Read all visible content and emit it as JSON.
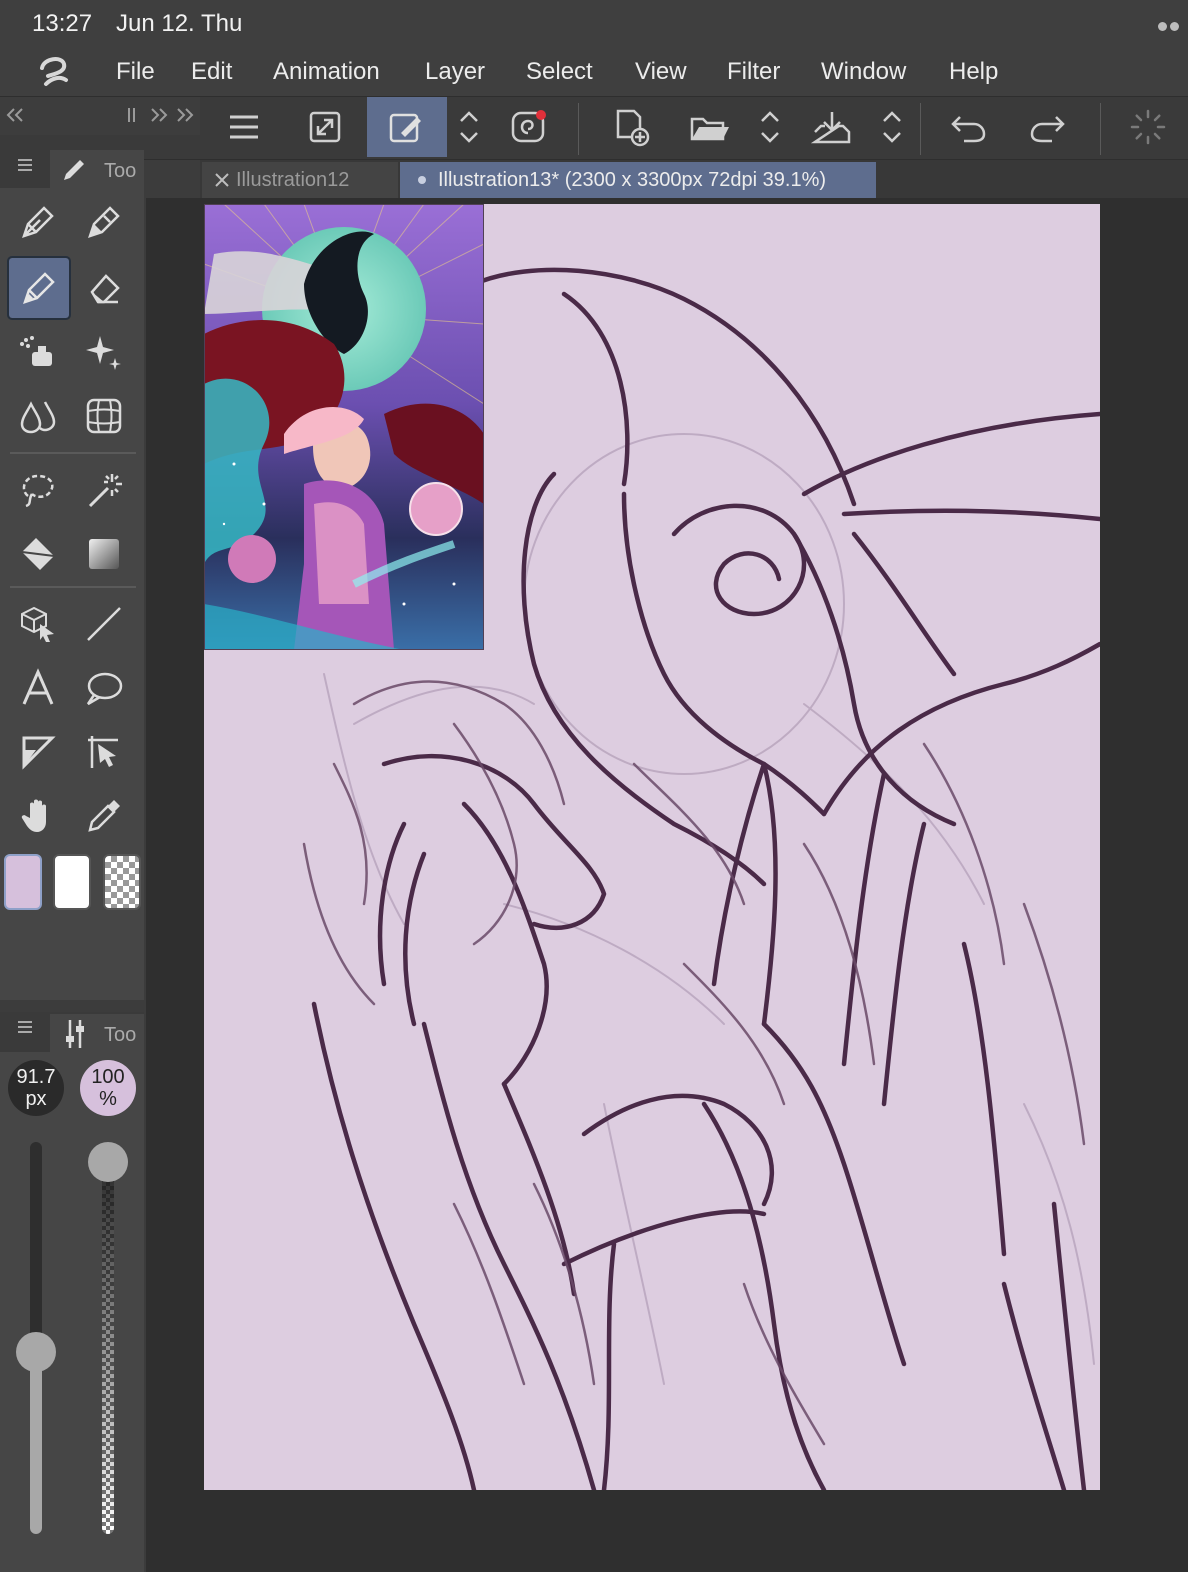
{
  "status_bar": {
    "time": "13:27",
    "date": "Jun 12. Thu"
  },
  "menu": [
    "File",
    "Edit",
    "Animation",
    "Layer",
    "Select",
    "View",
    "Filter",
    "Window",
    "Help"
  ],
  "tabs": [
    {
      "label": "Illustration12",
      "active": false
    },
    {
      "label": "Illustration13* (2300 x 3300px 72dpi 39.1%)",
      "active": true
    }
  ],
  "tool_panel": {
    "title": "Too"
  },
  "tool_property_panel": {
    "title": "Too"
  },
  "brush": {
    "size_value": "91.7",
    "size_unit": "px",
    "opacity_value": "100",
    "opacity_unit": "%",
    "size_level": 0.46,
    "opacity_level": 1.0
  },
  "colors": {
    "main": "#d6c0dc",
    "sub": "#ffffff",
    "accent": "#5e6d8e",
    "canvas_bg": "#ddcde0",
    "line": "#4a2a48"
  }
}
